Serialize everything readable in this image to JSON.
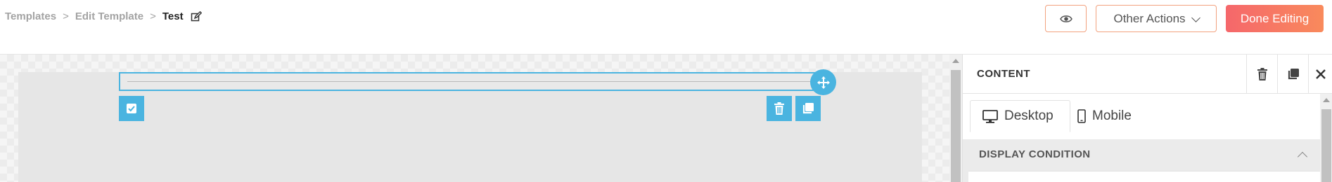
{
  "breadcrumb": {
    "items": [
      "Templates",
      "Edit Template"
    ],
    "separator": ">",
    "current": "Test",
    "edit_icon": "edit-icon"
  },
  "header_actions": {
    "preview_icon": "eye-icon",
    "other_actions_label": "Other Actions",
    "done_label": "Done Editing",
    "accent_color": "#f5676b"
  },
  "canvas": {
    "selection_color": "#4ab4e0",
    "tools": {
      "select_icon": "check-icon",
      "delete_icon": "trash-icon",
      "duplicate_icon": "duplicate-icon",
      "move_icon": "move-icon"
    }
  },
  "panel": {
    "title": "CONTENT",
    "tabs": [
      {
        "label": "Desktop",
        "icon": "desktop-icon",
        "active": true
      },
      {
        "label": "Mobile",
        "icon": "mobile-icon",
        "active": false
      }
    ],
    "section": {
      "title": "DISPLAY CONDITION",
      "expanded": true
    }
  }
}
